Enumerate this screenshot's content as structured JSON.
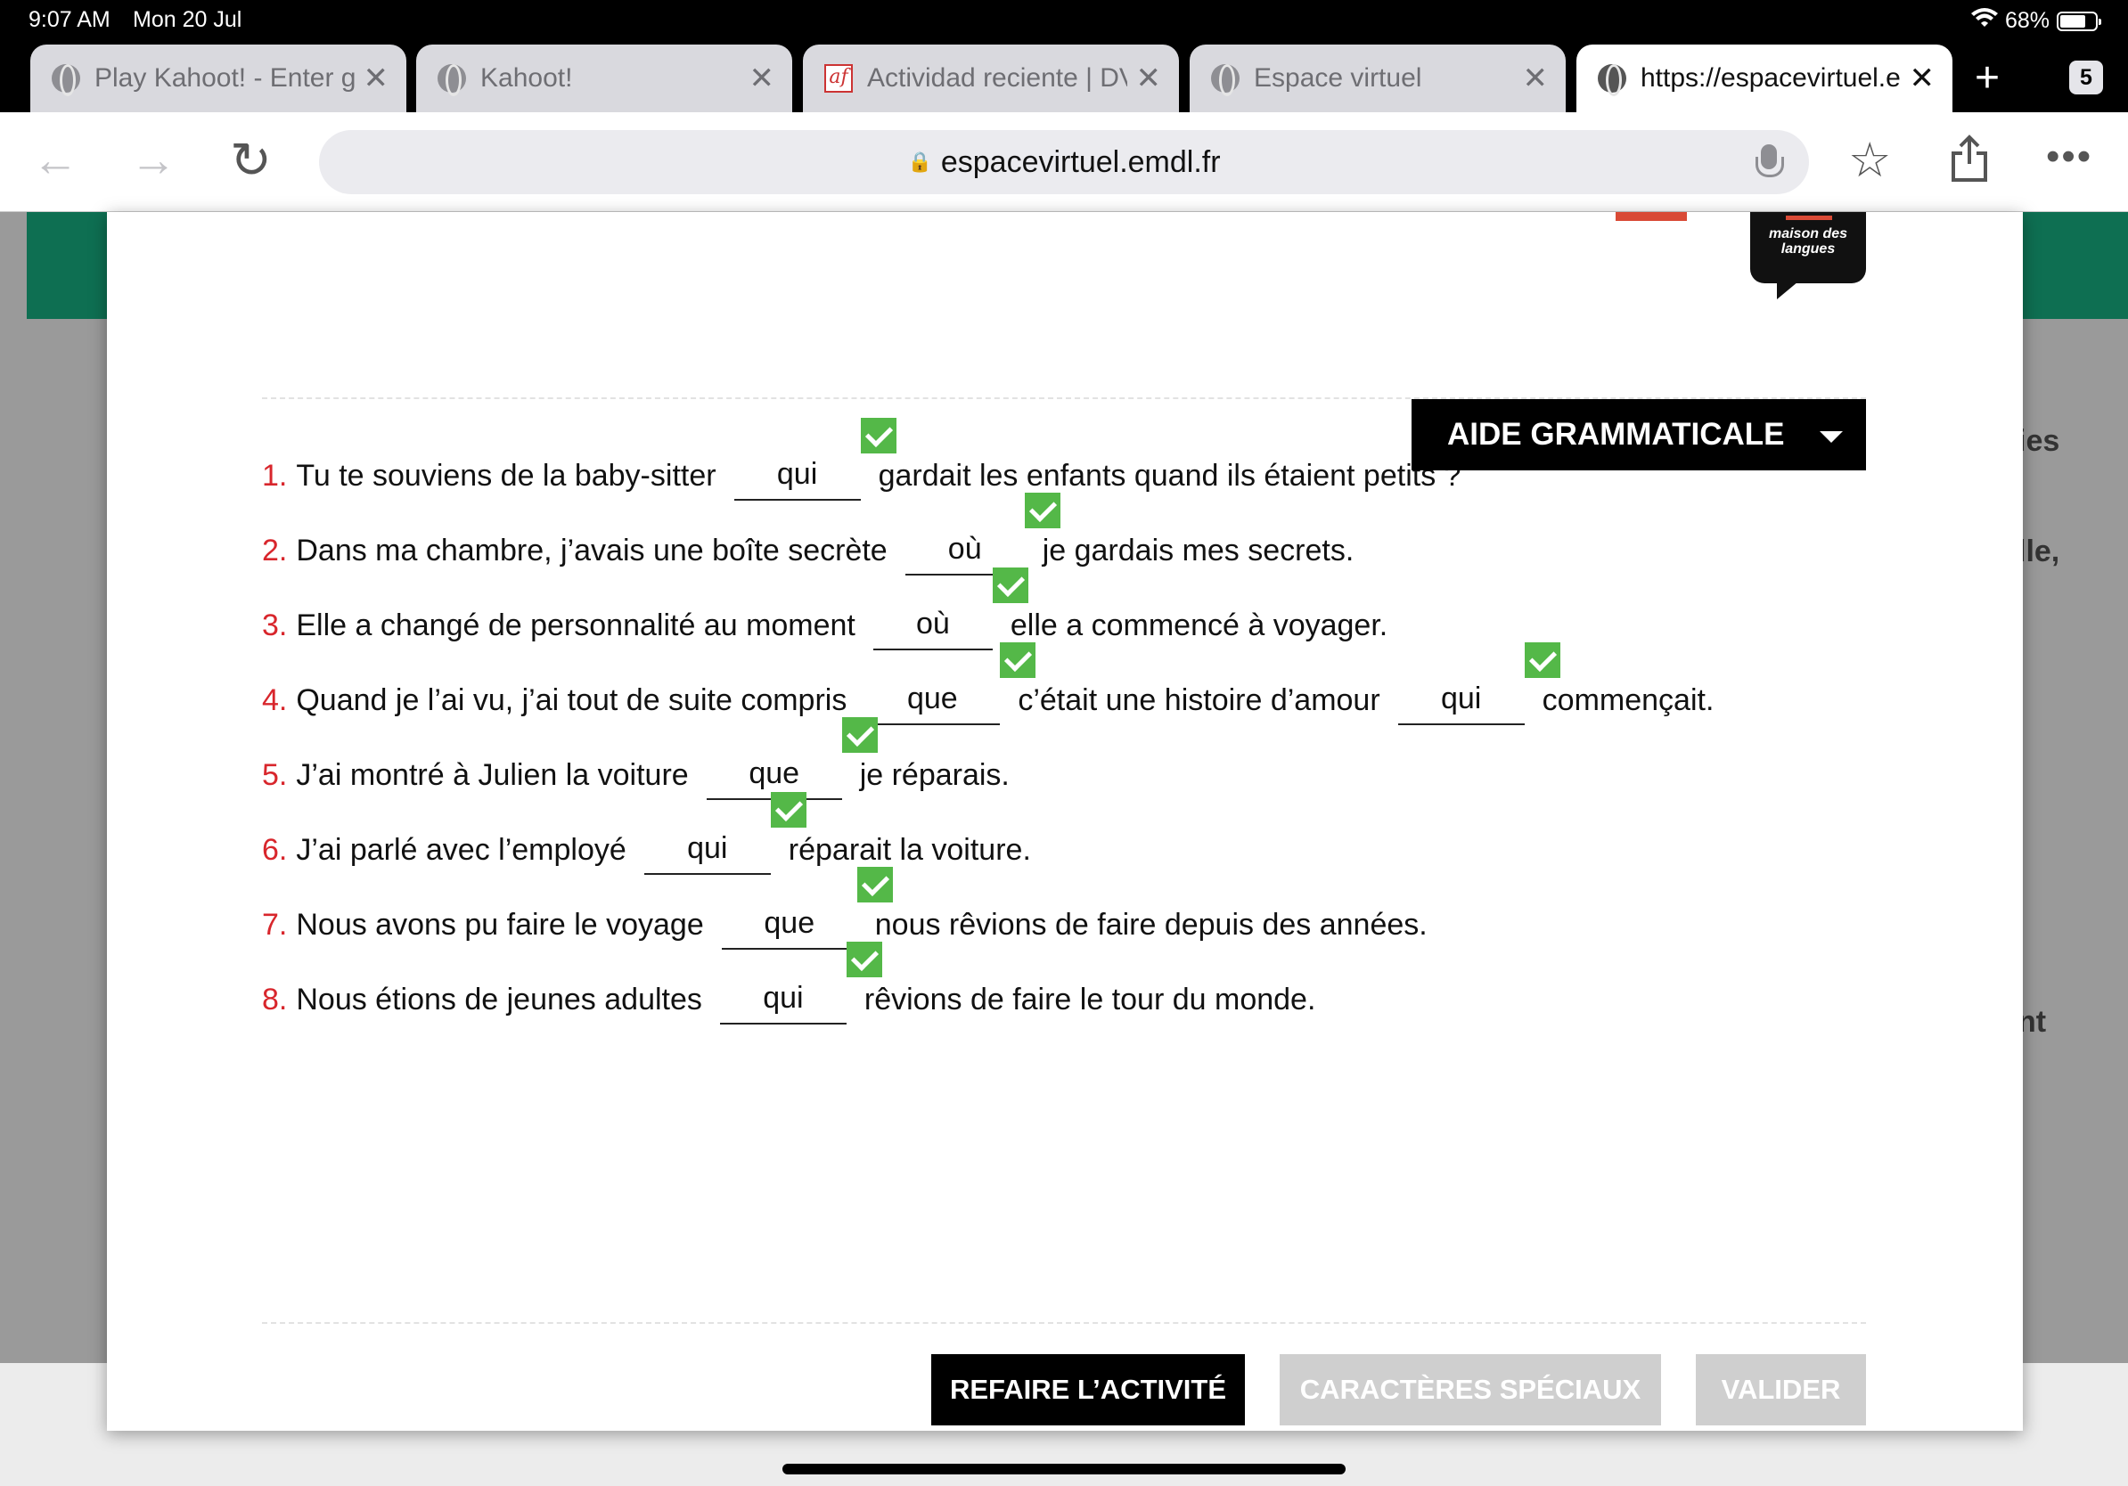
{
  "status_bar": {
    "time": "9:07 AM",
    "date": "Mon 20 Jul",
    "battery": "68%"
  },
  "tabs": [
    {
      "title": "Play Kahoot! - Enter game PIN",
      "icon": "globe-icon"
    },
    {
      "title": "Kahoot!",
      "icon": "globe-icon"
    },
    {
      "title": "Actividad reciente | DVD",
      "icon": "af-logo-icon"
    },
    {
      "title": "Espace virtuel",
      "icon": "globe-icon"
    },
    {
      "title": "https://espacevirtuel.emdl.fr",
      "icon": "globe-icon",
      "active": true
    }
  ],
  "tab_count": "5",
  "address_bar": {
    "url": "espacevirtuel.emdl.fr"
  },
  "logo": {
    "line1": "maison des",
    "line2": "langues"
  },
  "side_text": [
    "ies",
    "lle,",
    "nt"
  ],
  "grammar_help": {
    "label": "AIDE GRAMMATICALE"
  },
  "exercise": [
    {
      "num": "1.",
      "parts": [
        {
          "t": "Tu te souviens de la baby-sitter"
        },
        {
          "a": "qui",
          "correct": true
        },
        {
          "t": "gardait les enfants quand ils étaient petits ?"
        }
      ]
    },
    {
      "num": "2.",
      "parts": [
        {
          "t": "Dans ma chambre, j’avais une boîte secrète"
        },
        {
          "a": "où",
          "correct": true
        },
        {
          "t": "je gardais mes secrets."
        }
      ]
    },
    {
      "num": "3.",
      "parts": [
        {
          "t": "Elle a changé de personnalité au moment"
        },
        {
          "a": "où",
          "correct": true
        },
        {
          "t": "elle a commencé à voyager."
        }
      ]
    },
    {
      "num": "4.",
      "parts": [
        {
          "t": "Quand je l’ai vu, j’ai tout de suite compris"
        },
        {
          "a": "que",
          "correct": true
        },
        {
          "t": "c’était une histoire d’amour"
        },
        {
          "a": "qui",
          "correct": true
        },
        {
          "t": "commençait."
        }
      ]
    },
    {
      "num": "5.",
      "parts": [
        {
          "t": "J’ai montré à Julien la voiture"
        },
        {
          "a": "que",
          "correct": true
        },
        {
          "t": "je réparais."
        }
      ]
    },
    {
      "num": "6.",
      "parts": [
        {
          "t": "J’ai parlé avec l’employé"
        },
        {
          "a": "qui",
          "correct": true
        },
        {
          "t": "réparait la voiture."
        }
      ]
    },
    {
      "num": "7.",
      "parts": [
        {
          "t": "Nous avons pu faire le voyage"
        },
        {
          "a": "que",
          "correct": true
        },
        {
          "t": "nous rêvions de faire depuis des années."
        }
      ]
    },
    {
      "num": "8.",
      "parts": [
        {
          "t": "Nous étions de jeunes adultes"
        },
        {
          "a": "qui",
          "correct": true
        },
        {
          "t": "rêvions de faire le tour du monde."
        }
      ]
    }
  ],
  "buttons": {
    "redo": "REFAIRE L’ACTIVITÉ",
    "special_chars": "CARACTÈRES SPÉCIAUX",
    "validate": "VALIDER"
  },
  "colors": {
    "accent_red": "#d8262c",
    "check_green": "#54b848",
    "header_green": "#0e6f52"
  }
}
